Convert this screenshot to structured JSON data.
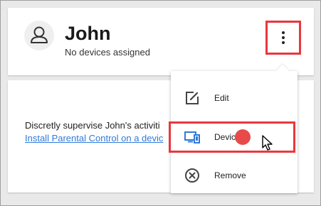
{
  "profile": {
    "name": "John",
    "status": "No devices assigned"
  },
  "body": {
    "message": "Discretly supervise John's activiti",
    "link": "Install Parental Control on a devic"
  },
  "menu": {
    "items": [
      {
        "label": "Edit",
        "icon": "edit-icon"
      },
      {
        "label": "Devices",
        "icon": "devices-icon"
      },
      {
        "label": "Remove",
        "icon": "remove-icon"
      }
    ]
  },
  "colors": {
    "highlight": "#e8383d",
    "link": "#2f7ad9",
    "devices_icon": "#2f7ad9",
    "hover_dot": "#e84a4a"
  },
  "icons": {
    "avatar": "user-avatar-icon",
    "kebab": "more-vertical-icon",
    "cursor": "mouse-pointer-icon"
  }
}
